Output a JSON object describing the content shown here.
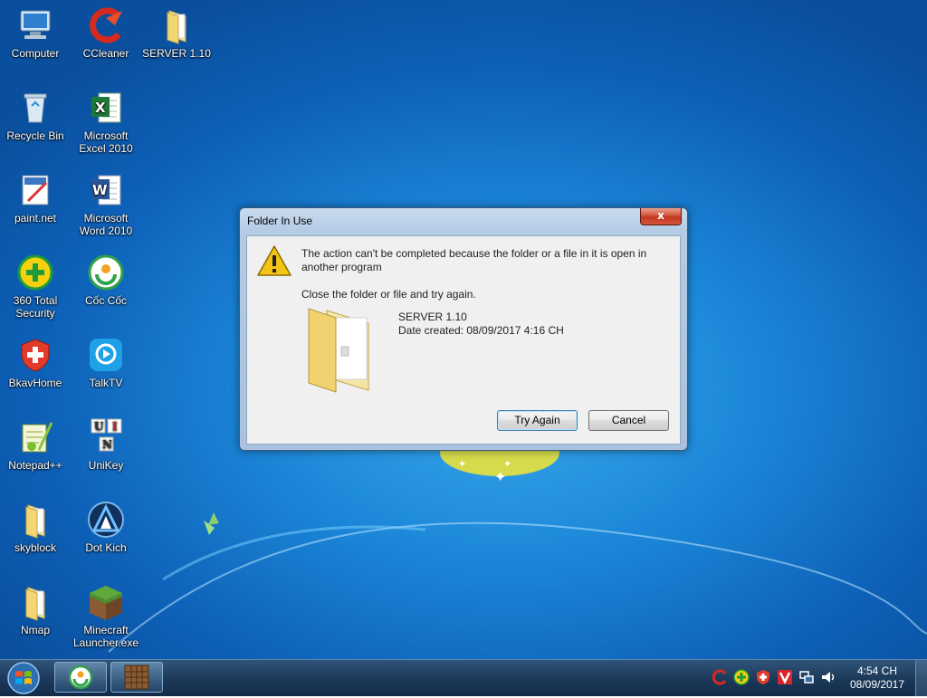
{
  "desktop": {
    "icons": [
      {
        "label": "Computer"
      },
      {
        "label": "CCleaner"
      },
      {
        "label": "SERVER 1.10"
      },
      {
        "label": "Recycle Bin"
      },
      {
        "label": "Microsoft Excel 2010"
      },
      {
        "label": "paint.net"
      },
      {
        "label": "Microsoft Word 2010"
      },
      {
        "label": "360 Total Security"
      },
      {
        "label": "Cốc Cốc"
      },
      {
        "label": "BkavHome"
      },
      {
        "label": "TalkTV"
      },
      {
        "label": "Notepad++"
      },
      {
        "label": "UniKey"
      },
      {
        "label": "skyblock"
      },
      {
        "label": "Dot Kich"
      },
      {
        "label": "Nmap"
      },
      {
        "label": "Minecraft Launcher.exe"
      }
    ]
  },
  "dialog": {
    "title": "Folder In Use",
    "close_label": "x",
    "message": "The action can't be completed because the folder or a file in it is open in another program",
    "instruction": "Close the folder or file and try again.",
    "file_name": "SERVER 1.10",
    "date_created": "Date created: 08/09/2017 4:16 CH",
    "try_again_label": "Try Again",
    "cancel_label": "Cancel"
  },
  "unikey_letters": {
    "u": "U",
    "i": "I",
    "n": "N"
  },
  "taskbar": {
    "clock_time": "4:54 CH",
    "clock_date": "08/09/2017"
  }
}
